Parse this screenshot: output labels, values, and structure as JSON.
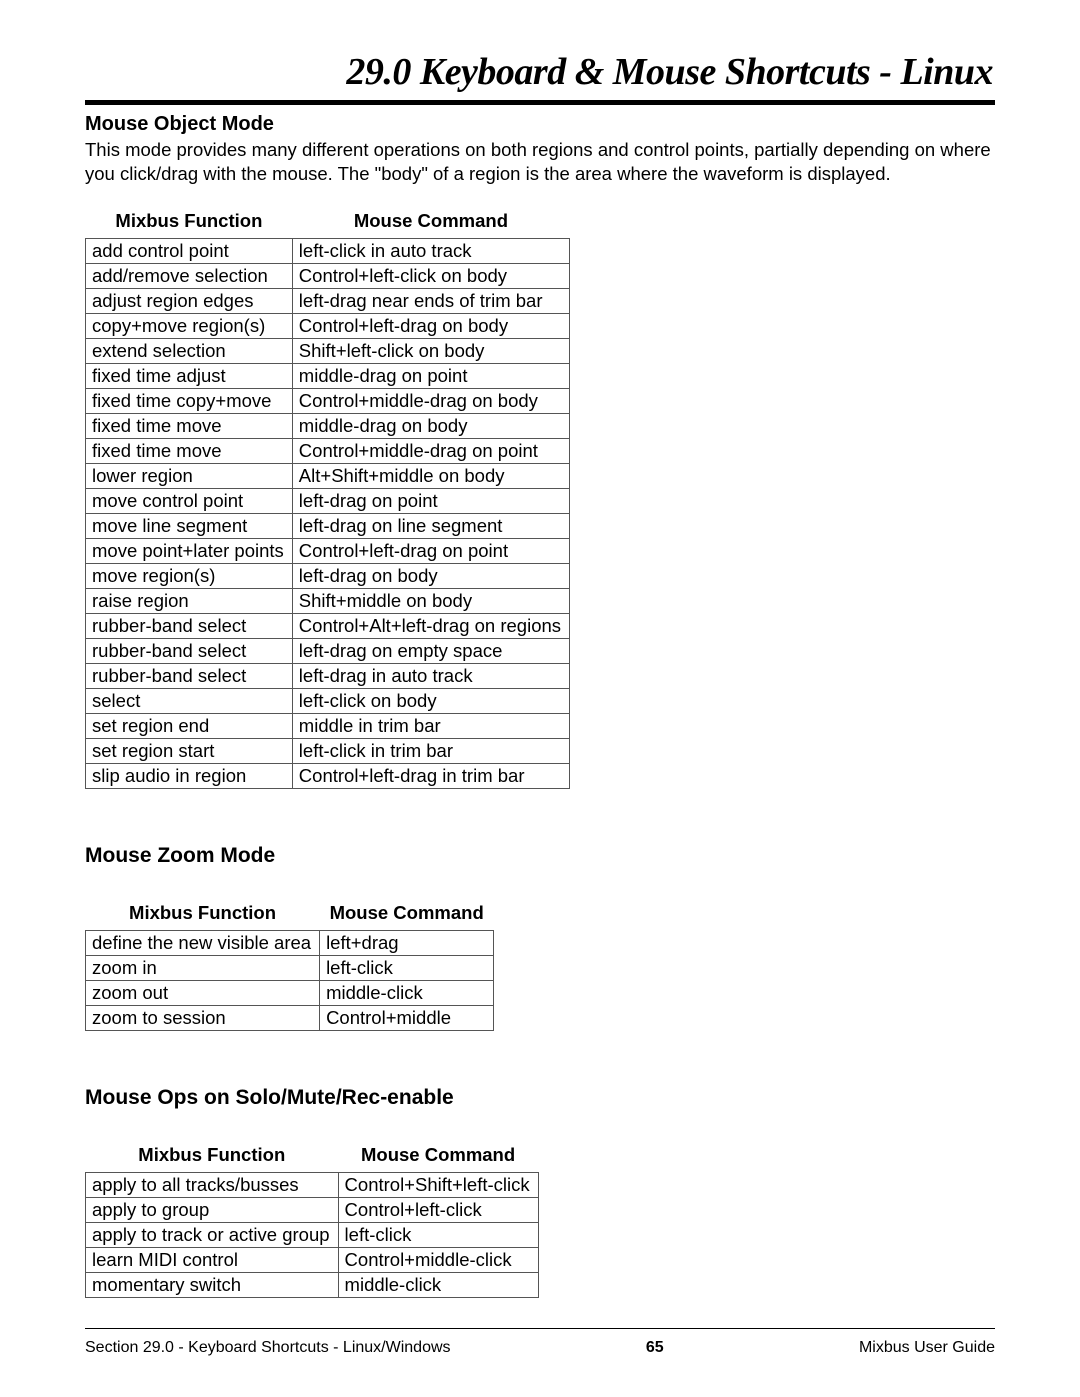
{
  "chapter_title": "29.0 Keyboard & Mouse Shortcuts - Linux",
  "sections": {
    "mouse_object": {
      "heading": "Mouse Object Mode",
      "body": "This mode provides many different operations on both regions and control points, partially depending on where you click/drag with the mouse. The \"body\" of a region is the area where the waveform is displayed.",
      "col1": "Mixbus Function",
      "col2": "Mouse Command",
      "rows": [
        {
          "f": "add control point",
          "c": "left-click in auto track"
        },
        {
          "f": "add/remove selection",
          "c": "Control+left-click on body"
        },
        {
          "f": "adjust region edges",
          "c": "left-drag near ends of trim bar"
        },
        {
          "f": "copy+move region(s)",
          "c": "Control+left-drag on body"
        },
        {
          "f": "extend selection",
          "c": "Shift+left-click on body"
        },
        {
          "f": "fixed time adjust",
          "c": "middle-drag on point"
        },
        {
          "f": "fixed time copy+move",
          "c": "Control+middle-drag on body"
        },
        {
          "f": "fixed time move",
          "c": "middle-drag on body"
        },
        {
          "f": "fixed time move",
          "c": "Control+middle-drag on point"
        },
        {
          "f": "lower region",
          "c": "Alt+Shift+middle on body"
        },
        {
          "f": "move control point",
          "c": "left-drag on point"
        },
        {
          "f": "move line segment",
          "c": "left-drag on line segment"
        },
        {
          "f": "move point+later points",
          "c": "Control+left-drag on point"
        },
        {
          "f": "move region(s)",
          "c": "left-drag on body"
        },
        {
          "f": "raise region",
          "c": "Shift+middle on body"
        },
        {
          "f": "rubber-band select",
          "c": "Control+Alt+left-drag on regions"
        },
        {
          "f": "rubber-band select",
          "c": "left-drag on empty space"
        },
        {
          "f": "rubber-band select",
          "c": "left-drag in auto track"
        },
        {
          "f": "select",
          "c": "left-click on body"
        },
        {
          "f": "set region end",
          "c": "middle in trim bar"
        },
        {
          "f": "set region start",
          "c": "left-click in trim bar"
        },
        {
          "f": "slip audio in region",
          "c": "Control+left-drag in trim bar"
        }
      ]
    },
    "mouse_zoom": {
      "heading": "Mouse Zoom Mode",
      "col1": "Mixbus Function",
      "col2": "Mouse Command",
      "rows": [
        {
          "f": "define the new visible area",
          "c": "left+drag"
        },
        {
          "f": "zoom in",
          "c": "left-click"
        },
        {
          "f": "zoom out",
          "c": "middle-click"
        },
        {
          "f": "zoom to session",
          "c": "Control+middle"
        }
      ]
    },
    "mouse_ops": {
      "heading": "Mouse Ops on Solo/Mute/Rec-enable",
      "col1": "Mixbus Function",
      "col2": "Mouse Command",
      "rows": [
        {
          "f": "apply to all tracks/busses",
          "c": "Control+Shift+left-click"
        },
        {
          "f": "apply to group",
          "c": "Control+left-click"
        },
        {
          "f": "apply to track or active group",
          "c": "left-click"
        },
        {
          "f": "learn MIDI control",
          "c": "Control+middle-click"
        },
        {
          "f": "momentary switch",
          "c": "middle-click"
        }
      ]
    }
  },
  "footer": {
    "left": "Section 29.0 - Keyboard Shortcuts - Linux/Windows",
    "center": "65",
    "right": "Mixbus User Guide"
  }
}
